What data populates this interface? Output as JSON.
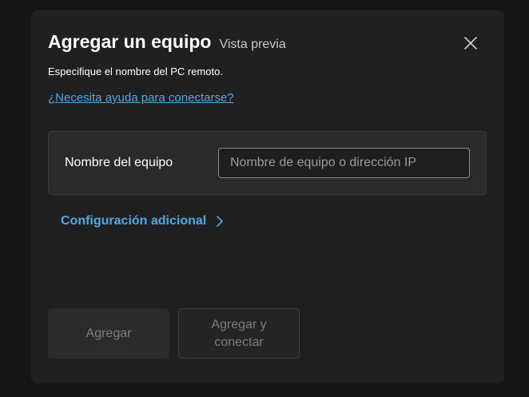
{
  "dialog": {
    "title": "Agregar un equipo",
    "preview_badge": "Vista previa",
    "subtitle": "Especifique el nombre del PC remoto.",
    "help_link": "¿Necesita ayuda para conectarse?",
    "field": {
      "label": "Nombre del equipo",
      "value": "",
      "placeholder": "Nombre de equipo o dirección IP"
    },
    "additional_config": {
      "label": "Configuración adicional",
      "icon": "chevron-right-icon"
    },
    "close_icon": "close-icon",
    "buttons": {
      "add": "Agregar",
      "add_connect": "Agregar y conectar"
    }
  },
  "colors": {
    "background": "#161616",
    "dialog": "#202020",
    "card": "#2a2a2a",
    "link": "#4ea8e8",
    "disabled_text": "#7c7c7c"
  }
}
